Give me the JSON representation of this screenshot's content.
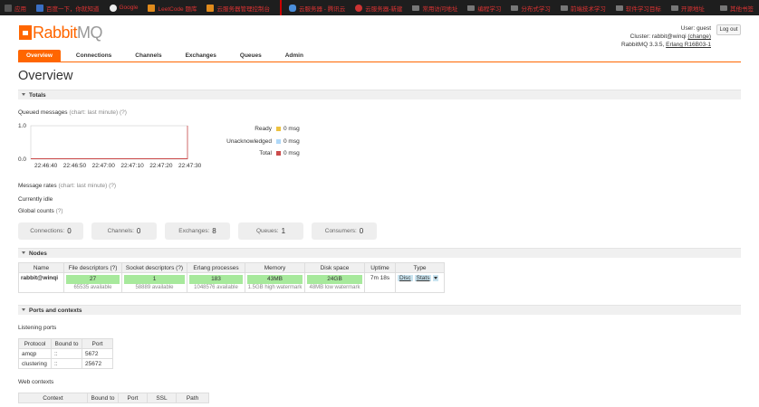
{
  "bookmarks": [
    {
      "label": "应用",
      "icon": "apps-icon"
    },
    {
      "label": "百度一下，你就知道",
      "icon": "baidu-icon"
    },
    {
      "label": "Google",
      "icon": "google-icon"
    },
    {
      "label": "LeetCode 题库",
      "icon": "leetcode-icon"
    },
    {
      "label": "云服务器管理控制台",
      "icon": "aliyun-icon"
    },
    {
      "label": "云服务器 - 腾讯云",
      "icon": "tencent-cloud-icon"
    },
    {
      "label": "云服务器-新建",
      "icon": "huawei-cloud-icon"
    },
    {
      "label": "常用访问地址",
      "icon": "folder-icon"
    },
    {
      "label": "编程学习",
      "icon": "folder-icon"
    },
    {
      "label": "分布式学习",
      "icon": "folder-icon"
    },
    {
      "label": "前端技术学习",
      "icon": "folder-icon"
    },
    {
      "label": "软件学习目标",
      "icon": "folder-icon"
    },
    {
      "label": "开源地址",
      "icon": "folder-icon"
    },
    {
      "label": "其他书签",
      "icon": "folder-icon"
    }
  ],
  "header": {
    "logo_rabbit": "Rabbit",
    "logo_mq": "MQ",
    "user_prefix": "User:",
    "user": "guest",
    "cluster_prefix": "Cluster:",
    "cluster": "rabbit@winqi",
    "change_label": "(change)",
    "version": "RabbitMQ 3.3.5,",
    "erlang": "Erlang R16B03-1",
    "logout_label": "Log out"
  },
  "tabs": [
    {
      "label": "Overview",
      "active": true
    },
    {
      "label": "Connections",
      "active": false
    },
    {
      "label": "Channels",
      "active": false
    },
    {
      "label": "Exchanges",
      "active": false
    },
    {
      "label": "Queues",
      "active": false
    },
    {
      "label": "Admin",
      "active": false
    }
  ],
  "page_title": "Overview",
  "totals": {
    "section_title": "Totals",
    "queued_label": "Queued messages",
    "queued_sub": "(chart: last minute)",
    "help": "(?)",
    "legend": [
      {
        "label": "Ready",
        "value": "0 msg",
        "color": "#edc240"
      },
      {
        "label": "Unacknowledged",
        "value": "0 msg",
        "color": "#afd8f8"
      },
      {
        "label": "Total",
        "value": "0 msg",
        "color": "#cb4b4b"
      }
    ],
    "rates_label": "Message rates",
    "rates_sub": "(chart: last minute)",
    "idle": "Currently idle",
    "global_label": "Global counts",
    "counts": [
      {
        "label": "Connections:",
        "value": "0"
      },
      {
        "label": "Channels:",
        "value": "0"
      },
      {
        "label": "Exchanges:",
        "value": "8"
      },
      {
        "label": "Queues:",
        "value": "1"
      },
      {
        "label": "Consumers:",
        "value": "0"
      }
    ]
  },
  "chart_data": {
    "type": "line",
    "x": [
      "22:46:40",
      "22:46:50",
      "22:47:00",
      "22:47:10",
      "22:47:20",
      "22:47:30"
    ],
    "yticks": [
      "1.0",
      "0.0"
    ],
    "ylim": [
      0,
      1
    ],
    "series": [
      {
        "name": "Ready",
        "values": [
          0,
          0,
          0,
          0,
          0,
          0
        ]
      },
      {
        "name": "Unacknowledged",
        "values": [
          0,
          0,
          0,
          0,
          0,
          0
        ]
      },
      {
        "name": "Total",
        "values": [
          0,
          0,
          0,
          0,
          0,
          0
        ]
      }
    ]
  },
  "nodes": {
    "section_title": "Nodes",
    "headers": [
      "Name",
      "File descriptors",
      "Socket descriptors",
      "Erlang processes",
      "Memory",
      "Disk space",
      "Uptime",
      "Type"
    ],
    "help": "(?)",
    "row": {
      "name": "rabbit@winqi",
      "fd": "27",
      "fd_sub": "65535 available",
      "sd": "1",
      "sd_sub": "58889 available",
      "ep": "183",
      "ep_sub": "1048576 available",
      "mem": "43MB",
      "mem_sub": "1.5GB high watermark",
      "disk": "24GB",
      "disk_sub": "48MB low watermark",
      "uptime": "7m 18s",
      "type_disc": "Disc",
      "type_stats": "Stats"
    }
  },
  "ports": {
    "section_title": "Ports and contexts",
    "listening_label": "Listening ports",
    "headers": [
      "Protocol",
      "Bound to",
      "Port"
    ],
    "rows": [
      {
        "protocol": "amqp",
        "bound": "::",
        "port": "5672"
      },
      {
        "protocol": "clustering",
        "bound": "::",
        "port": "25672"
      }
    ],
    "web_label": "Web contexts",
    "web_headers": [
      "Context",
      "Bound to",
      "Port",
      "SSL",
      "Path"
    ]
  }
}
